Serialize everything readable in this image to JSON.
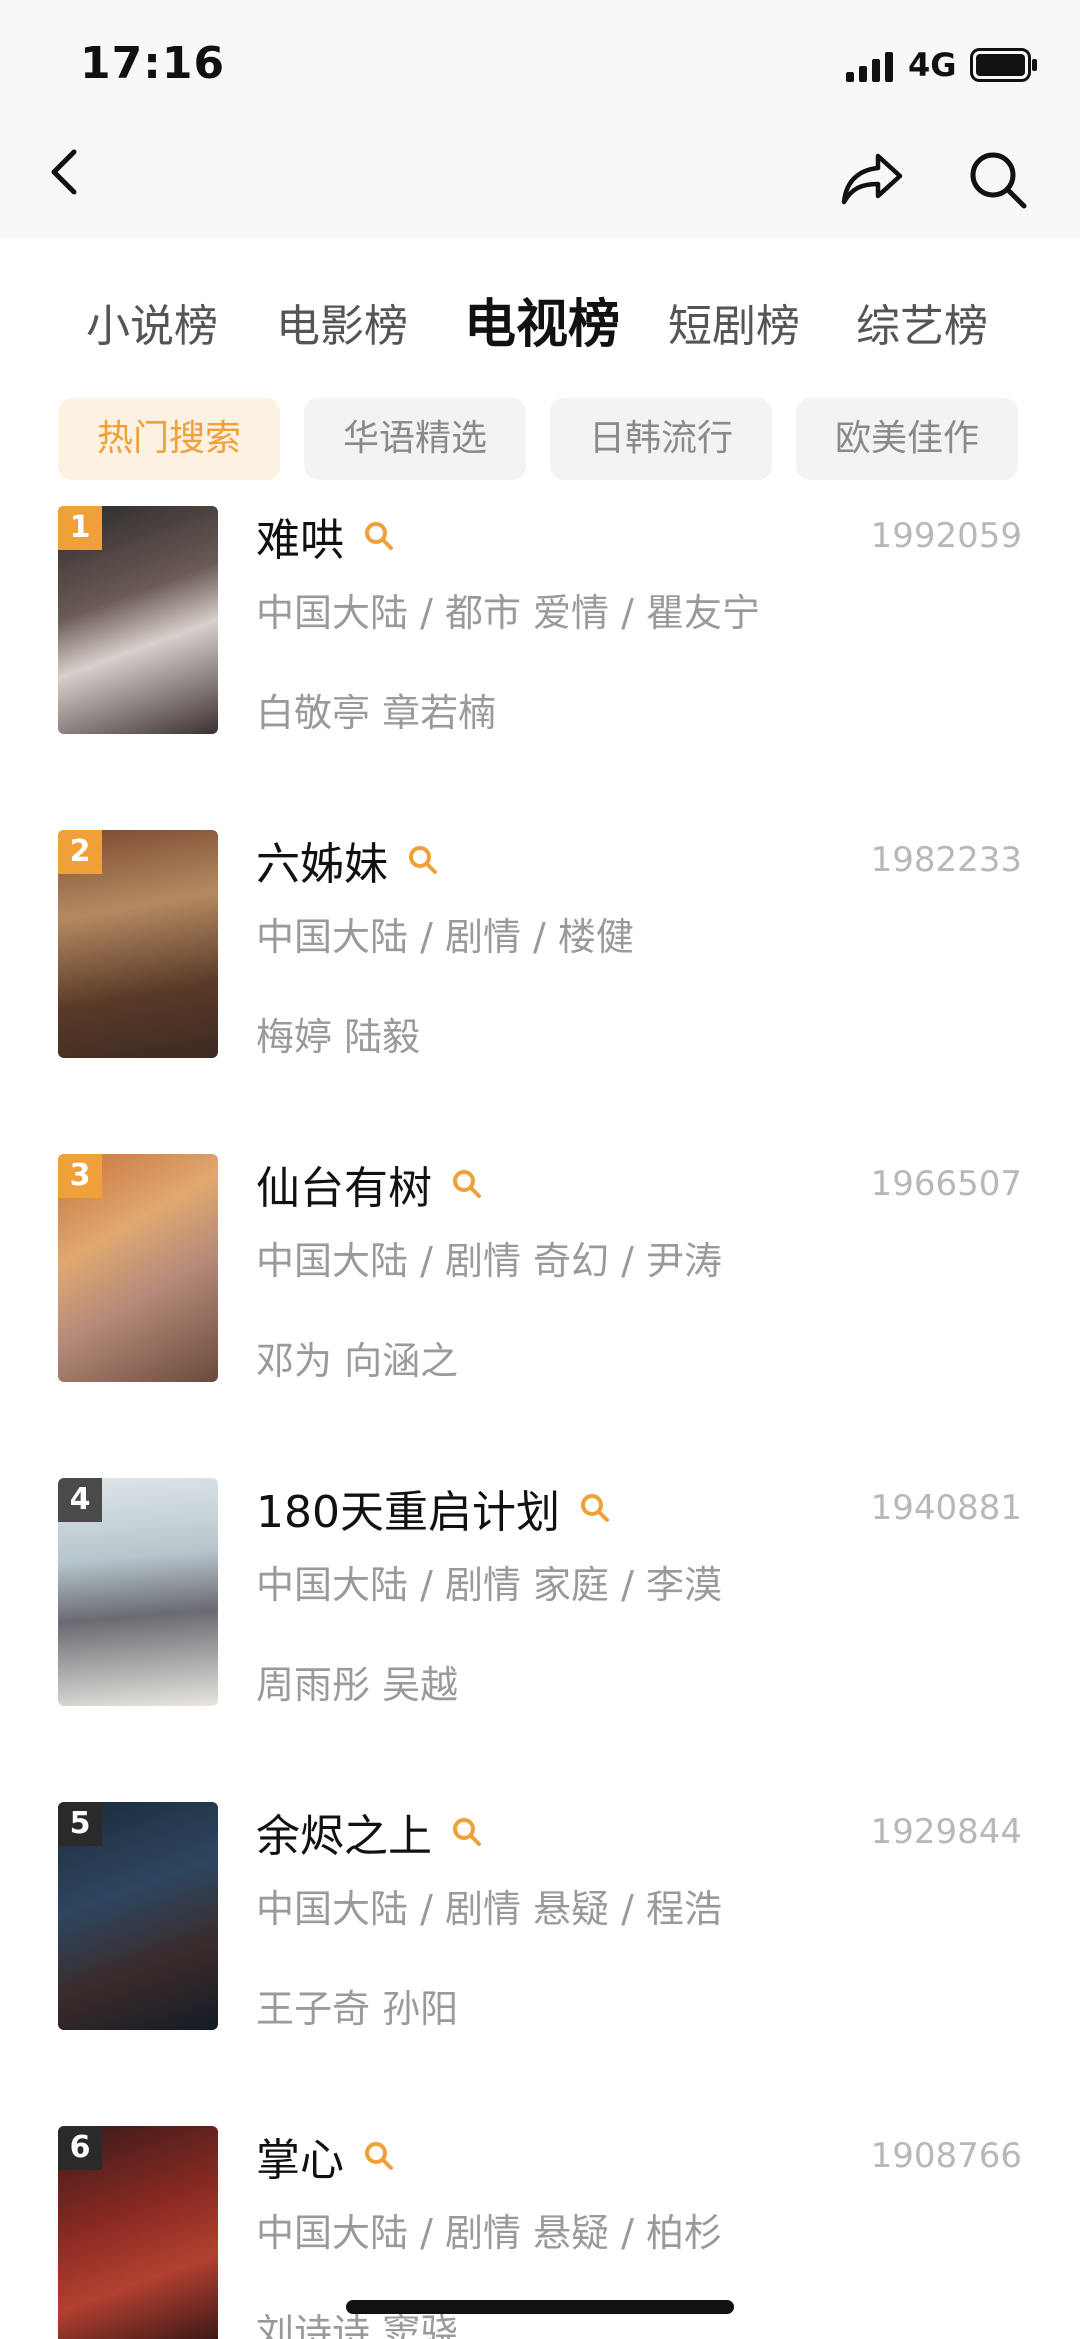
{
  "status_bar": {
    "time": "17:16",
    "network": "4G"
  },
  "nav": {
    "back_icon": "chevron-left-icon",
    "share_icon": "share-icon",
    "search_icon": "search-icon"
  },
  "tabs": [
    {
      "label": "小说榜",
      "active": false
    },
    {
      "label": "电影榜",
      "active": false
    },
    {
      "label": "电视榜",
      "active": true
    },
    {
      "label": "短剧榜",
      "active": false
    },
    {
      "label": "综艺榜",
      "active": false
    }
  ],
  "chips": [
    {
      "label": "热门搜索",
      "active": true
    },
    {
      "label": "华语精选",
      "active": false
    },
    {
      "label": "日韩流行",
      "active": false
    },
    {
      "label": "欧美佳作",
      "active": false
    }
  ],
  "colors": {
    "accent": "#f0a038",
    "rank_top": "#f0a038",
    "rank_other": "#4a4a4a",
    "muted_text": "#9a9a9a"
  },
  "items": [
    {
      "rank": "1",
      "title": "难哄",
      "score": "1992059",
      "meta": "中国大陆 / 都市 爱情 / 瞿友宁",
      "cast": "白敬亭 章若楠"
    },
    {
      "rank": "2",
      "title": "六姊妹",
      "score": "1982233",
      "meta": "中国大陆 / 剧情 / 楼健",
      "cast": "梅婷 陆毅"
    },
    {
      "rank": "3",
      "title": "仙台有树",
      "score": "1966507",
      "meta": "中国大陆 / 剧情 奇幻 / 尹涛",
      "cast": "邓为 向涵之"
    },
    {
      "rank": "4",
      "title": "180天重启计划",
      "score": "1940881",
      "meta": "中国大陆 / 剧情 家庭 / 李漠",
      "cast": "周雨彤 吴越"
    },
    {
      "rank": "5",
      "title": "余烬之上",
      "score": "1929844",
      "meta": "中国大陆 / 剧情 悬疑 / 程浩",
      "cast": "王子奇 孙阳"
    },
    {
      "rank": "6",
      "title": "掌心",
      "score": "1908766",
      "meta": "中国大陆 / 剧情 悬疑 / 柏杉",
      "cast": "刘诗诗 窦骁"
    }
  ]
}
